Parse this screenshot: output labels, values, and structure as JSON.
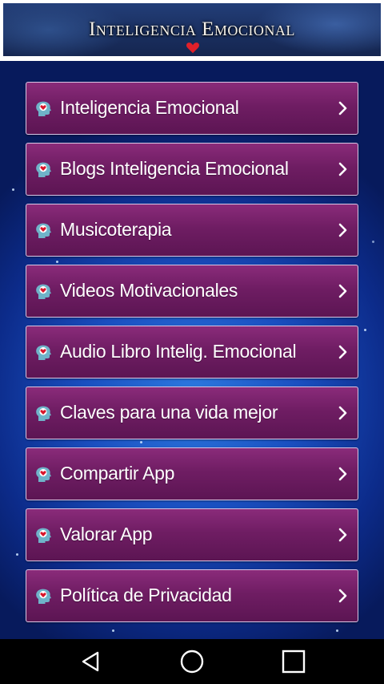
{
  "header": {
    "title": "Inteligencia Emocional",
    "heart_icon": "heart-icon"
  },
  "menu": {
    "items": [
      {
        "label": "Inteligencia Emocional",
        "icon": "brain-heart-icon"
      },
      {
        "label": "Blogs Inteligencia Emocional",
        "icon": "brain-heart-icon"
      },
      {
        "label": "Musicoterapia",
        "icon": "brain-heart-icon"
      },
      {
        "label": "Videos Motivacionales",
        "icon": "brain-heart-icon"
      },
      {
        "label": "Audio Libro Intelig. Emocional",
        "icon": "brain-heart-icon"
      },
      {
        "label": "Claves para una vida mejor",
        "icon": "brain-heart-icon"
      },
      {
        "label": "Compartir App",
        "icon": "brain-heart-icon"
      },
      {
        "label": "Valorar App",
        "icon": "brain-heart-icon"
      },
      {
        "label": "Política de Privacidad",
        "icon": "brain-heart-icon"
      }
    ],
    "item_color": "#6f1d63",
    "chevron_icon": "chevron-right-icon"
  },
  "navbar": {
    "back_icon": "back-triangle-icon",
    "home_icon": "home-circle-icon",
    "recents_icon": "recents-square-icon"
  },
  "colors": {
    "background": "#1a4fc0",
    "navbar": "#000000"
  }
}
